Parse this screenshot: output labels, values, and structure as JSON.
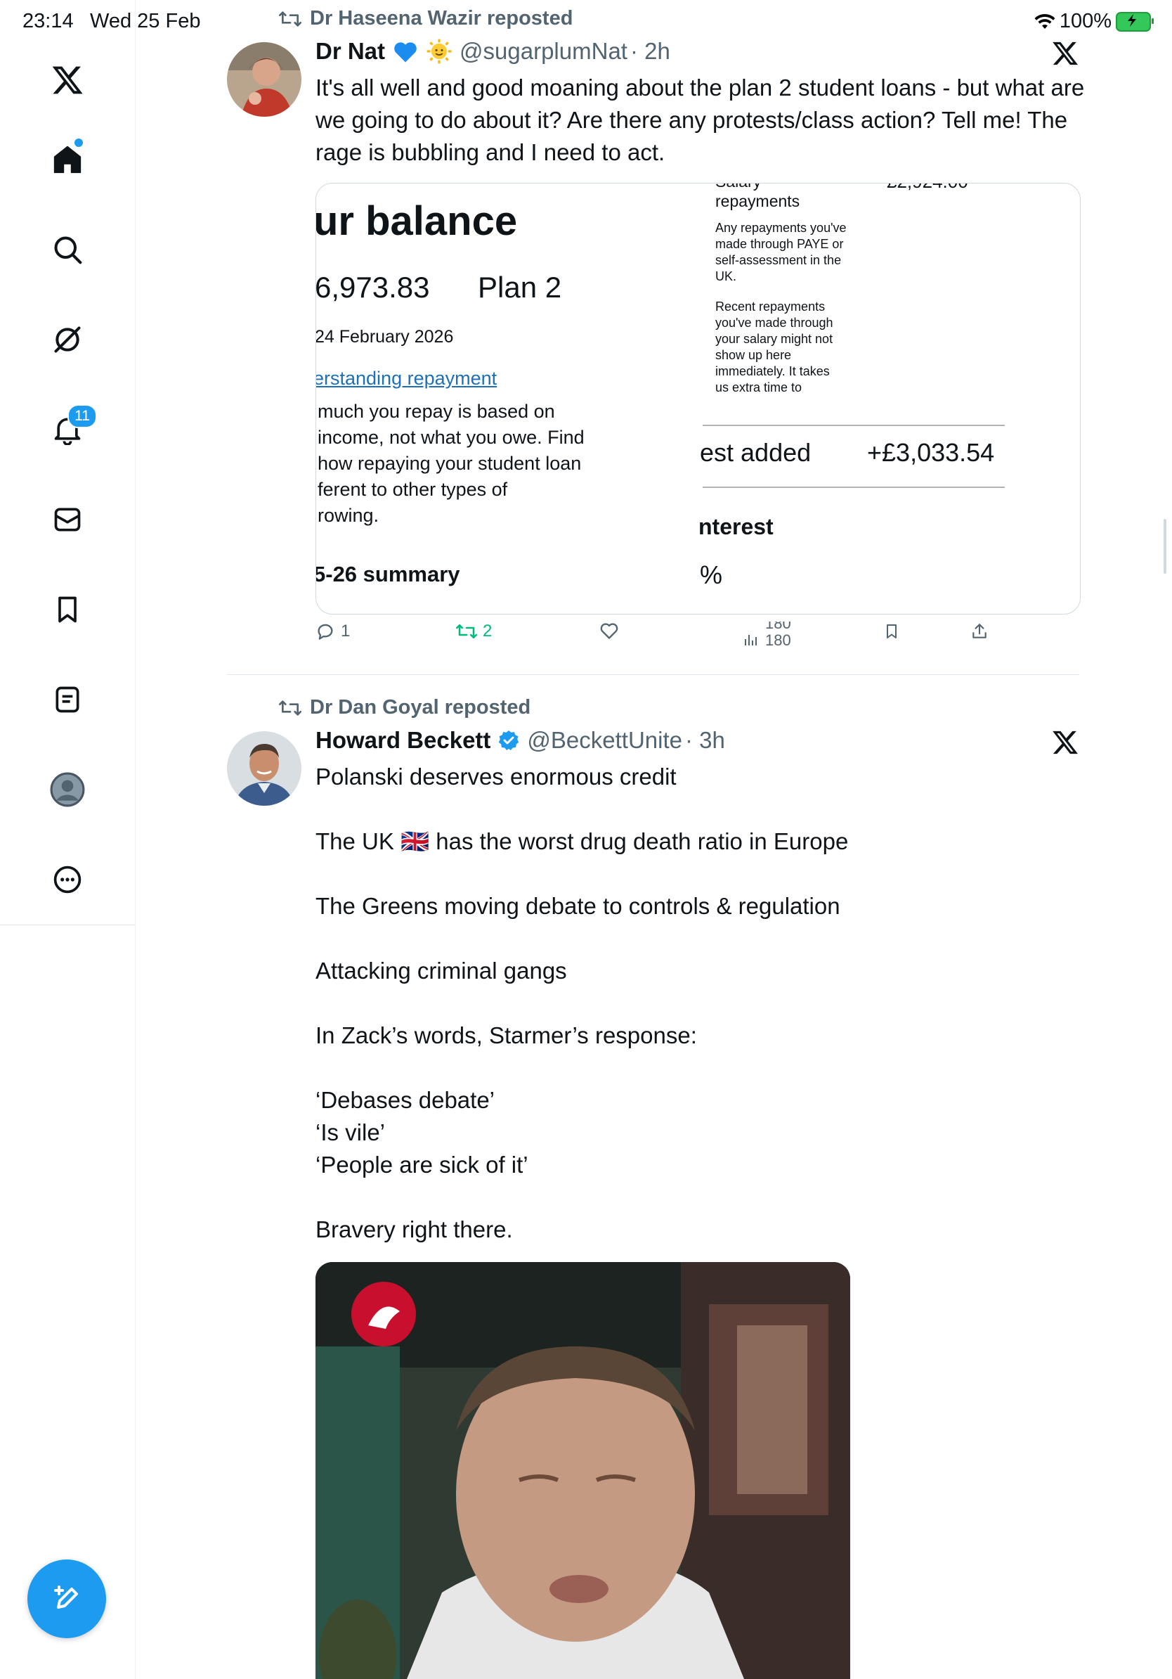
{
  "status_bar": {
    "time": "23:14",
    "date": "Wed 25 Feb",
    "battery": "100%"
  },
  "sidebar": {
    "notification_count": "11"
  },
  "colors": {
    "accent": "#1d9bf0",
    "retweet_green": "#00ba7c",
    "secondary_text": "#536471"
  },
  "tweets": [
    {
      "repost_by": "Dr Haseena Wazir reposted",
      "name": "Dr Nat",
      "emojis": [
        "blue-heart",
        "smiling-sun"
      ],
      "handle": "@sugarplumNat",
      "time": "· 2h",
      "text": "It's all well and good moaning about the plan 2 student loans - but what are we going to do about it? Are there any protests/class action? Tell me! The rage is bubbling and I need to act.",
      "image": {
        "left": {
          "heading": "ur balance",
          "amount": "6,973.83",
          "plan": "Plan 2",
          "date": "24 February 2026",
          "link": "erstanding repayment",
          "para": "much you repay is based on\nincome, not what you owe. Find\nhow repaying your student loan\nferent to other types of\nrowing.",
          "summary": "5-26 summary"
        },
        "right": {
          "top_cut": "Salary",
          "top_amount_cut": "£2,924.00",
          "label": "repayments",
          "note1": "Any repayments you've\nmade through PAYE or\nself-assessment in the\nUK.",
          "note2": "Recent repayments\nyou've made through\nyour salary might not\nshow up here\nimmediately. It takes\nus extra time to",
          "interest_label": "est added",
          "interest_amount": "+£3,033.54",
          "interest_heading": "nterest",
          "percent": "%"
        }
      },
      "stats": {
        "replies": "1",
        "reposts": "2",
        "views_a": "180",
        "views_b": "180"
      }
    },
    {
      "repost_by": "Dr Dan Goyal reposted",
      "name": "Howard Beckett",
      "verified": true,
      "handle": "@BeckettUnite",
      "time": "· 3h",
      "text": "Polanski deserves enormous credit\n\nThe UK 🇬🇧 has the worst drug death ratio in Europe\n\nThe Greens moving debate to controls & regulation\n\nAttacking criminal gangs\n\nIn Zack’s words, Starmer’s response:\n\n‘Debases debate’\n‘Is vile’\n‘People are sick of it’\n\nBravery right there.",
      "video_thumbnail": "man-speaking-outdoors"
    }
  ]
}
